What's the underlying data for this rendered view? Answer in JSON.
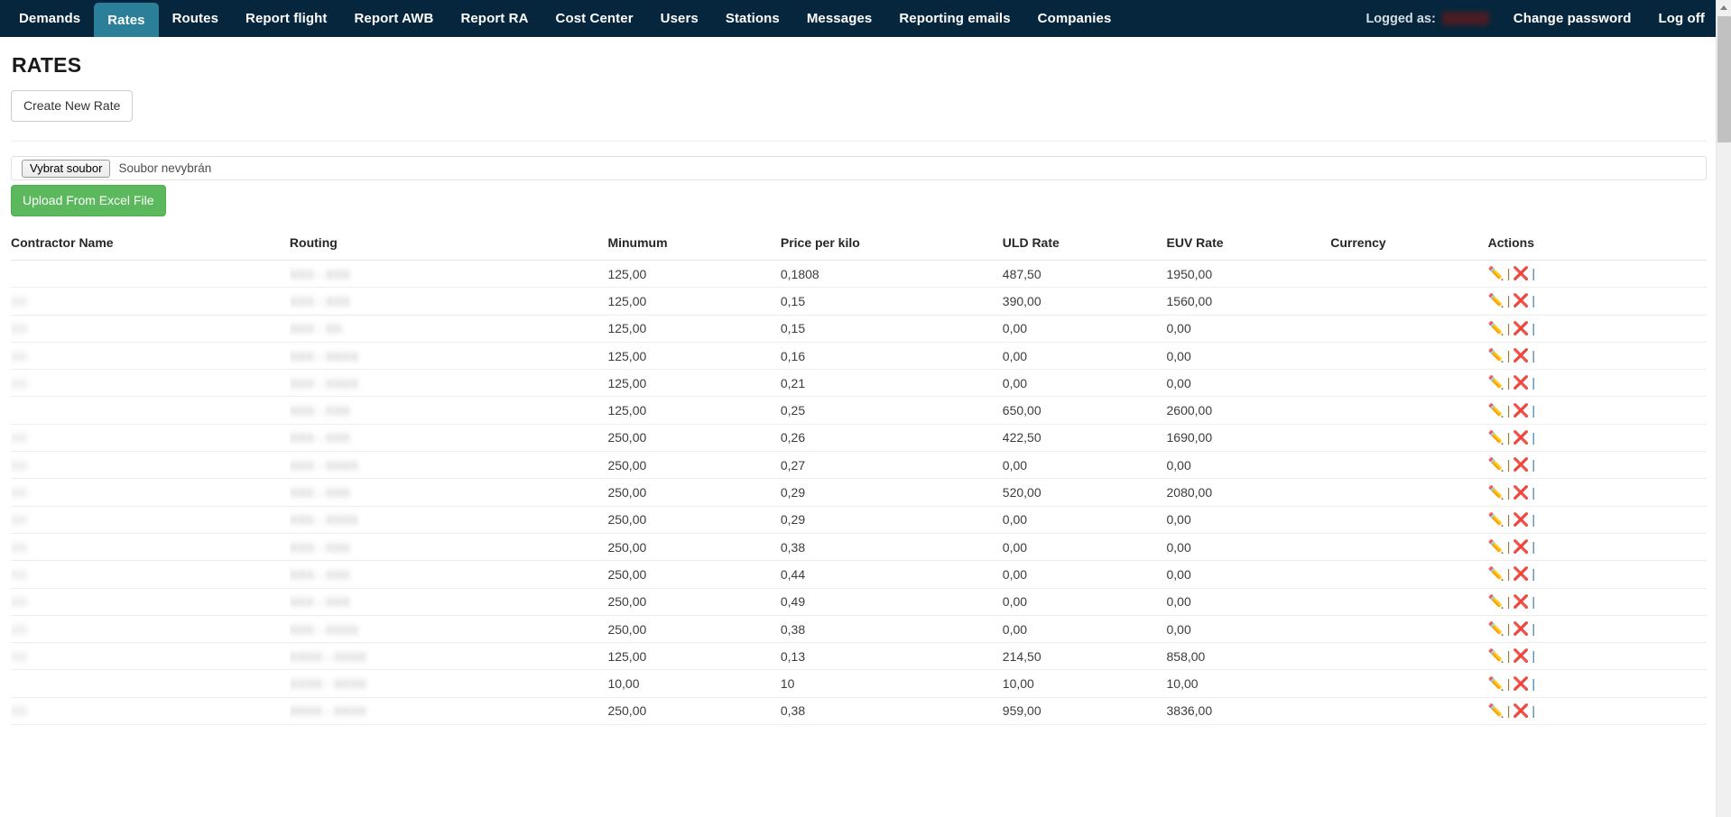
{
  "nav": {
    "items": [
      {
        "label": "Demands",
        "active": false
      },
      {
        "label": "Rates",
        "active": true
      },
      {
        "label": "Routes",
        "active": false
      },
      {
        "label": "Report flight",
        "active": false
      },
      {
        "label": "Report AWB",
        "active": false
      },
      {
        "label": "Report RA",
        "active": false
      },
      {
        "label": "Cost Center",
        "active": false
      },
      {
        "label": "Users",
        "active": false
      },
      {
        "label": "Stations",
        "active": false
      },
      {
        "label": "Messages",
        "active": false
      },
      {
        "label": "Reporting emails",
        "active": false
      },
      {
        "label": "Companies",
        "active": false
      }
    ],
    "logged_as_label": "Logged as:",
    "logged_as_value": "",
    "change_password": "Change password",
    "log_off": "Log off",
    "active_color": "#2b7f99",
    "bar_color": "#05263c"
  },
  "page": {
    "title": "RATES",
    "create_button": "Create New Rate"
  },
  "upload": {
    "file_button": "Vybrat soubor",
    "file_name": "Soubor nevybrán",
    "submit_button": "Upload From Excel File",
    "submit_color": "#5cb85c"
  },
  "table": {
    "columns": [
      "Contractor Name",
      "Routing",
      "Minumum",
      "Price per kilo",
      "ULD Rate",
      "EUV Rate",
      "Currency",
      "Actions"
    ],
    "action_icons": {
      "edit": "✏️",
      "separator": "|",
      "delete": "❌",
      "separator2": "|"
    },
    "rows": [
      {
        "contractor": "",
        "routing": "XXX - XXX",
        "minimum": "125,00",
        "price": "0,1808",
        "uld": "487,50",
        "euv": "1950,00",
        "currency": ""
      },
      {
        "contractor": "XX",
        "routing": "XXX - XXX",
        "minimum": "125,00",
        "price": "0,15",
        "uld": "390,00",
        "euv": "1560,00",
        "currency": ""
      },
      {
        "contractor": "XX",
        "routing": "XXX - XX",
        "minimum": "125,00",
        "price": "0,15",
        "uld": "0,00",
        "euv": "0,00",
        "currency": ""
      },
      {
        "contractor": "XX",
        "routing": "XXX - XXXX",
        "minimum": "125,00",
        "price": "0,16",
        "uld": "0,00",
        "euv": "0,00",
        "currency": ""
      },
      {
        "contractor": "XX",
        "routing": "XXX - XXXX",
        "minimum": "125,00",
        "price": "0,21",
        "uld": "0,00",
        "euv": "0,00",
        "currency": ""
      },
      {
        "contractor": "",
        "routing": "XXX - XXX",
        "minimum": "125,00",
        "price": "0,25",
        "uld": "650,00",
        "euv": "2600,00",
        "currency": ""
      },
      {
        "contractor": "XX",
        "routing": "XXX - XXX",
        "minimum": "250,00",
        "price": "0,26",
        "uld": "422,50",
        "euv": "1690,00",
        "currency": ""
      },
      {
        "contractor": "XX",
        "routing": "XXX - XXXX",
        "minimum": "250,00",
        "price": "0,27",
        "uld": "0,00",
        "euv": "0,00",
        "currency": ""
      },
      {
        "contractor": "XX",
        "routing": "XXX - XXX",
        "minimum": "250,00",
        "price": "0,29",
        "uld": "520,00",
        "euv": "2080,00",
        "currency": ""
      },
      {
        "contractor": "XX",
        "routing": "XXX - XXXX",
        "minimum": "250,00",
        "price": "0,29",
        "uld": "0,00",
        "euv": "0,00",
        "currency": ""
      },
      {
        "contractor": "XX",
        "routing": "XXX - XXX",
        "minimum": "250,00",
        "price": "0,38",
        "uld": "0,00",
        "euv": "0,00",
        "currency": ""
      },
      {
        "contractor": "XX",
        "routing": "XXX - XXX",
        "minimum": "250,00",
        "price": "0,44",
        "uld": "0,00",
        "euv": "0,00",
        "currency": ""
      },
      {
        "contractor": "XX",
        "routing": "XXX - XXX",
        "minimum": "250,00",
        "price": "0,49",
        "uld": "0,00",
        "euv": "0,00",
        "currency": ""
      },
      {
        "contractor": "XX",
        "routing": "XXX - XXXX",
        "minimum": "250,00",
        "price": "0,38",
        "uld": "0,00",
        "euv": "0,00",
        "currency": ""
      },
      {
        "contractor": "XX",
        "routing": "XXXX - XXXX",
        "minimum": "125,00",
        "price": "0,13",
        "uld": "214,50",
        "euv": "858,00",
        "currency": ""
      },
      {
        "contractor": "",
        "routing": "XXXX - XXXX",
        "minimum": "10,00",
        "price": "10",
        "uld": "10,00",
        "euv": "10,00",
        "currency": ""
      },
      {
        "contractor": "XX",
        "routing": "XXXX - XXXX",
        "minimum": "250,00",
        "price": "0,38",
        "uld": "959,00",
        "euv": "3836,00",
        "currency": ""
      }
    ]
  }
}
